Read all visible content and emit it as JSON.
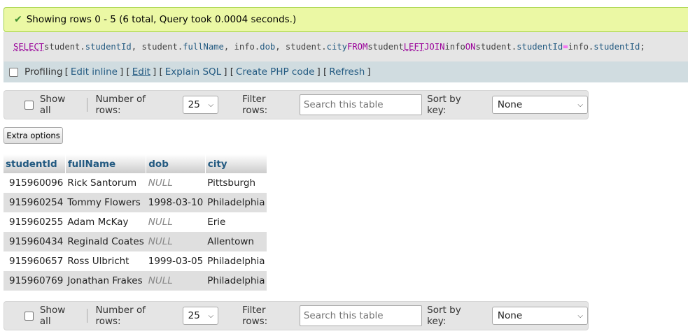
{
  "status": {
    "message": "Showing rows 0 - 5 (6 total, Query took 0.0004 seconds.)",
    "icon": "checkmark-icon",
    "color": "#ebf8a4"
  },
  "query": {
    "kw_select": "SELECT",
    "seg1": " student.",
    "col1": "studentId",
    "seg2": ", student.",
    "col2": "fullName",
    "seg3": ", info.",
    "col3": "dob",
    "seg4": ", student.",
    "col4": "city",
    "seg5": " ",
    "kw_from": "FROM",
    "seg6": " student ",
    "kw_left": "LEFT",
    "seg7": " ",
    "kw_join": "JOIN",
    "seg8": " info ",
    "kw_on": "ON",
    "seg9": " student.",
    "col5": "studentId",
    "seg10": " ",
    "op_eq": "=",
    "seg11": " info.",
    "col6": "studentId",
    "seg12": ";"
  },
  "actions": {
    "profiling_label": "Profiling",
    "edit_inline": "Edit inline",
    "edit": "Edit",
    "explain_sql": "Explain SQL",
    "create_php": "Create PHP code",
    "refresh": "Refresh",
    "open_bracket": "[",
    "close_bracket": "]",
    "between": "] ["
  },
  "nav": {
    "show_all": "Show all",
    "rows_label": "Number of rows:",
    "rows_value": "25",
    "filter_label": "Filter rows:",
    "filter_placeholder": "Search this table",
    "sort_label": "Sort by key:",
    "sort_value": "None"
  },
  "extra_options": "Extra options",
  "table": {
    "headers": [
      "studentId",
      "fullName",
      "dob",
      "city"
    ],
    "rows": [
      [
        "915960096",
        "Rick Santorum",
        "NULL",
        "Pittsburgh"
      ],
      [
        "915960254",
        "Tommy Flowers",
        "1998-03-10",
        "Philadelphia"
      ],
      [
        "915960255",
        "Adam McKay",
        "NULL",
        "Erie"
      ],
      [
        "915960434",
        "Reginald Coates",
        "NULL",
        "Allentown"
      ],
      [
        "915960657",
        "Ross Ulbricht",
        "1999-03-05",
        "Philadelphia"
      ],
      [
        "915960769",
        "Jonathan Frakes",
        "NULL",
        "Philadelphia"
      ]
    ]
  },
  "colors": {
    "link": "#235a81",
    "sql_keyword": "#990099",
    "panel_bg": "#e5e5e5",
    "links_bar_bg": "#d0dce0"
  }
}
